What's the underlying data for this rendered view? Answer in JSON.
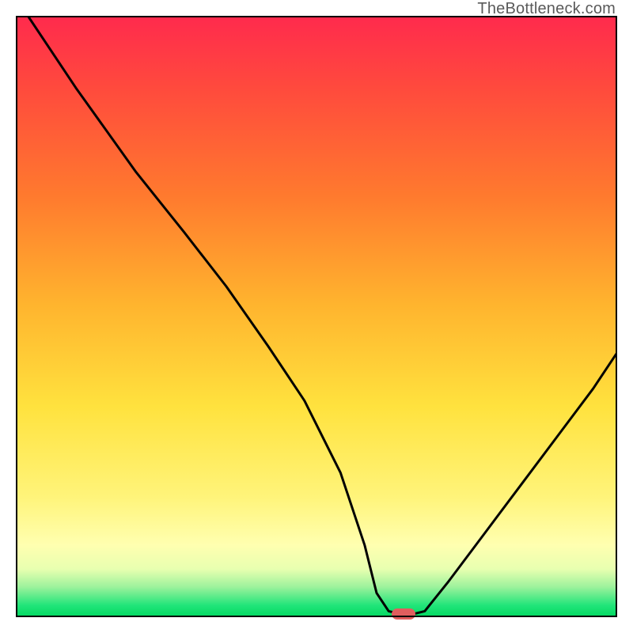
{
  "watermark": "TheBottleneck.com",
  "colors": {
    "frame": "#000000",
    "curve": "#000000",
    "marker": "#e15e5e",
    "gradient_top": "#ff2a4d",
    "gradient_mid": "#ffe23e",
    "gradient_bottom": "#00d860"
  },
  "marker": {
    "x_frac": 0.645,
    "y_frac": 0.995
  },
  "chart_data": {
    "type": "line",
    "title": "",
    "xlabel": "",
    "ylabel": "",
    "xlim": [
      0,
      100
    ],
    "ylim": [
      0,
      100
    ],
    "annotations": [
      "TheBottleneck.com"
    ],
    "legend": false,
    "grid": false,
    "series": [
      {
        "name": "curve",
        "x": [
          2,
          10,
          20,
          28,
          35,
          42,
          48,
          54,
          58,
          60,
          62,
          64,
          66,
          68,
          72,
          78,
          84,
          90,
          96,
          100
        ],
        "y": [
          100,
          88,
          74,
          64,
          55,
          45,
          36,
          24,
          12,
          4,
          1,
          0.5,
          0.5,
          1,
          6,
          14,
          22,
          30,
          38,
          44
        ]
      }
    ],
    "optimum_marker": {
      "x": 64.5,
      "y": 0.5
    }
  }
}
